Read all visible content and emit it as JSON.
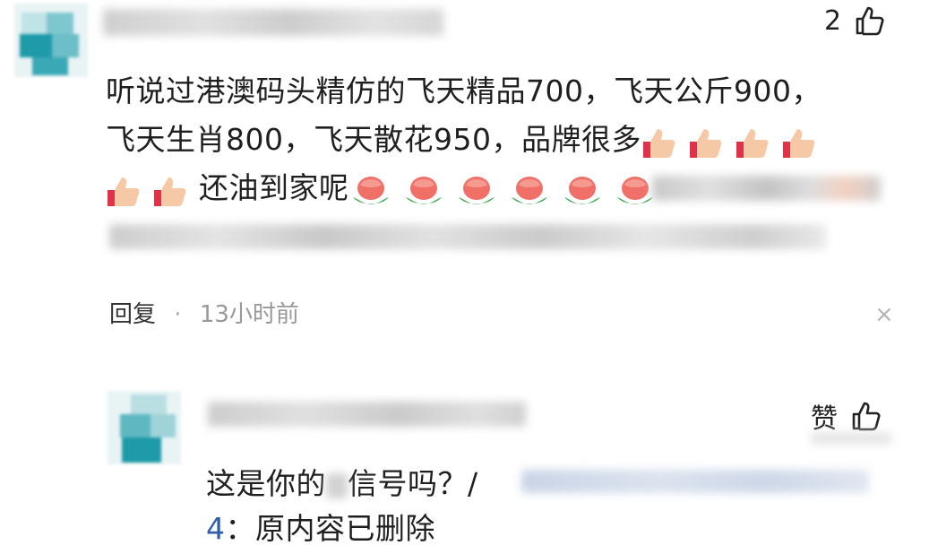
{
  "comment1": {
    "like_count": "2",
    "line1": "听说过港澳码头精仿的飞天精品700，飞天公斤900，",
    "line2": "飞天生肖800，飞天散花950，品牌很多",
    "line3": "还油到家呢",
    "reply_label": "回复",
    "separator": "·",
    "time": "13小时前",
    "close_symbol": "×"
  },
  "comment2": {
    "like_label": "赞",
    "line1_prefix": "这是你的",
    "line1_suffix": "信号吗？/",
    "line2_number": "4",
    "line2_text": "：原内容已删除"
  },
  "colors": {
    "avatar_teal": "#1f9aa8",
    "avatar_light": "#9fd6dc",
    "blur_gray": "#d7d7d7"
  },
  "icons": [
    "thumbs-up-icon",
    "thumbs-up-emoji",
    "rose-emoji",
    "close-icon"
  ]
}
